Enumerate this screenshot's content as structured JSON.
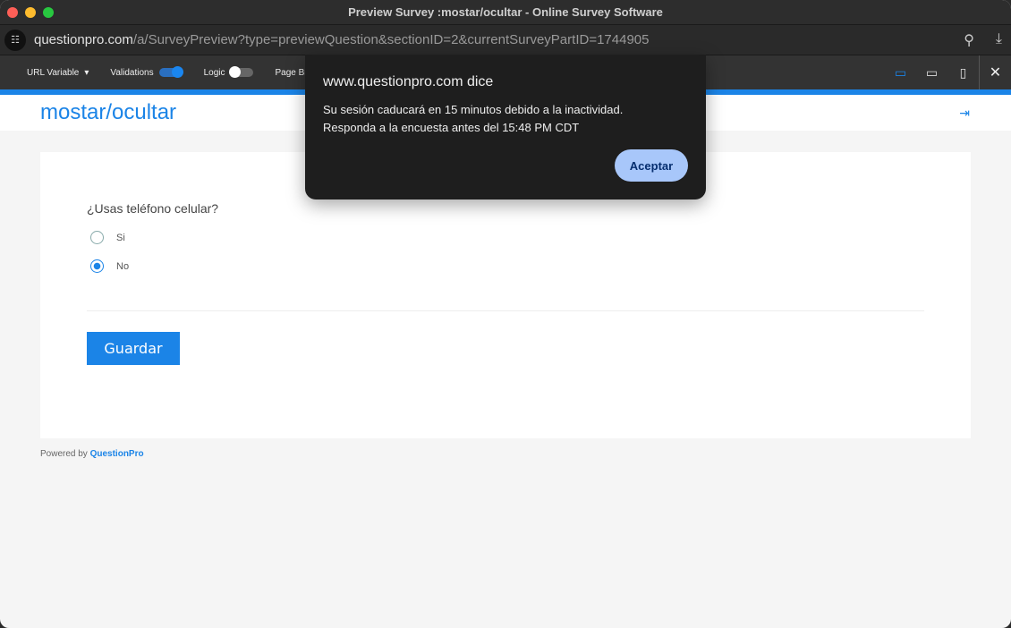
{
  "window": {
    "title": "Preview Survey :mostar/ocultar - Online Survey Software"
  },
  "browser": {
    "url_host": "questionpro.com",
    "url_path": "/a/SurveyPreview?type=previewQuestion&sectionID=2&currentSurveyPartID=1744905"
  },
  "toolbar": {
    "url_variable": "URL Variable",
    "validations": "Validations",
    "logic": "Logic",
    "page_break": "Page Br"
  },
  "survey": {
    "title": "mostar/ocultar",
    "question": "¿Usas teléfono celular?",
    "options": [
      "Si",
      "No"
    ],
    "selected": "No",
    "save_label": "Guardar",
    "powered_by": "Powered by ",
    "brand": "QuestionPro"
  },
  "dialog": {
    "title": "www.questionpro.com dice",
    "line1": "Su sesión caducará en 15 minutos debido a la inactividad.",
    "line2": "Responda a la encuesta antes del 15:48 PM CDT",
    "accept": "Aceptar"
  }
}
